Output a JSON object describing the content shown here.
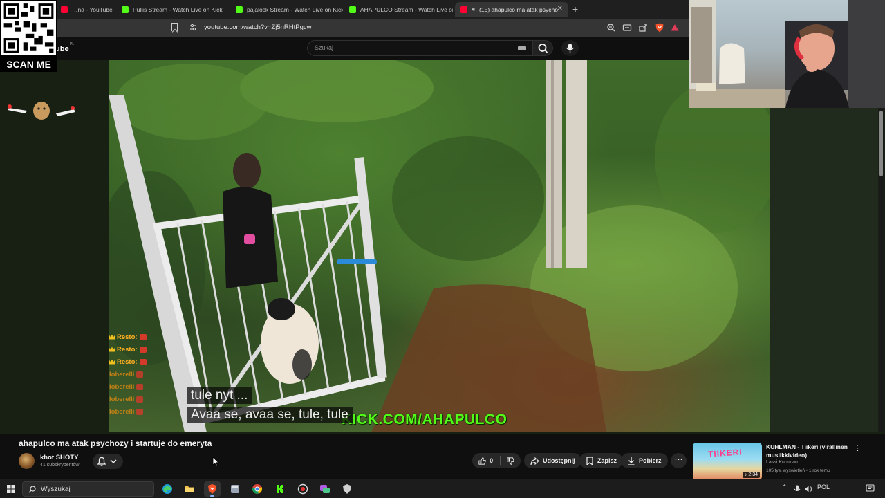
{
  "browser": {
    "tabs": [
      {
        "label": "…na - YouTube",
        "favicon": "youtube-favicon"
      },
      {
        "label": "Pullis Stream - Watch Live on Kick",
        "favicon": "kick-favicon"
      },
      {
        "label": "pajalock Stream - Watch Live on Kick",
        "favicon": "kick-favicon"
      },
      {
        "label": "AHAPULCO Stream - Watch Live on Kick",
        "favicon": "kick-favicon"
      },
      {
        "label": "(15) ahapulco ma atak psycho",
        "favicon": "youtube-favicon",
        "active": true
      }
    ],
    "url": "youtube.com/watch?v=Zj5nRHtPgcw"
  },
  "youtube": {
    "logo_text": "ube",
    "logo_country": "PL",
    "search_placeholder": "Szukaj"
  },
  "overlay": {
    "qr_caption": "SCAN ME",
    "kick_text": "KICK.COM/AHAPULCO",
    "subtitles": [
      "tule nyt ...",
      "Avaa se, avaa se, tule, tule"
    ],
    "chat": [
      {
        "user": "Resto:",
        "style": "crown"
      },
      {
        "user": "Resto:",
        "style": "crown"
      },
      {
        "user": "Resto:",
        "style": "crown"
      },
      {
        "user": "loberelli",
        "style": "faded"
      },
      {
        "user": "loberelli",
        "style": "faded"
      },
      {
        "user": "loberelli",
        "style": "faded"
      },
      {
        "user": "loberelli",
        "style": "faded"
      }
    ]
  },
  "video": {
    "title": "ahapulco ma atak psychozy i startuje do emeryta",
    "channel": "khot SHOTY",
    "subscribers": "41 subskrybentów",
    "likes": "0",
    "share_label": "Udostępnij",
    "save_label": "Zapisz",
    "download_label": "Pobierz"
  },
  "recommendation": {
    "title": "KUHLMAN - Tiikeri (virallinen musiikkivideo)",
    "channel": "Lassi Kuhlman",
    "meta": "105 tys. wyświetleń • 1 rok temu",
    "duration": "2:34",
    "thumb_text": "TIIKERI"
  },
  "taskbar": {
    "search_placeholder": "Wyszukaj",
    "language": "POL"
  },
  "colors": {
    "kick_green": "#53fc18",
    "youtube_red": "#ff0033",
    "chat_gold": "#ffb020"
  }
}
